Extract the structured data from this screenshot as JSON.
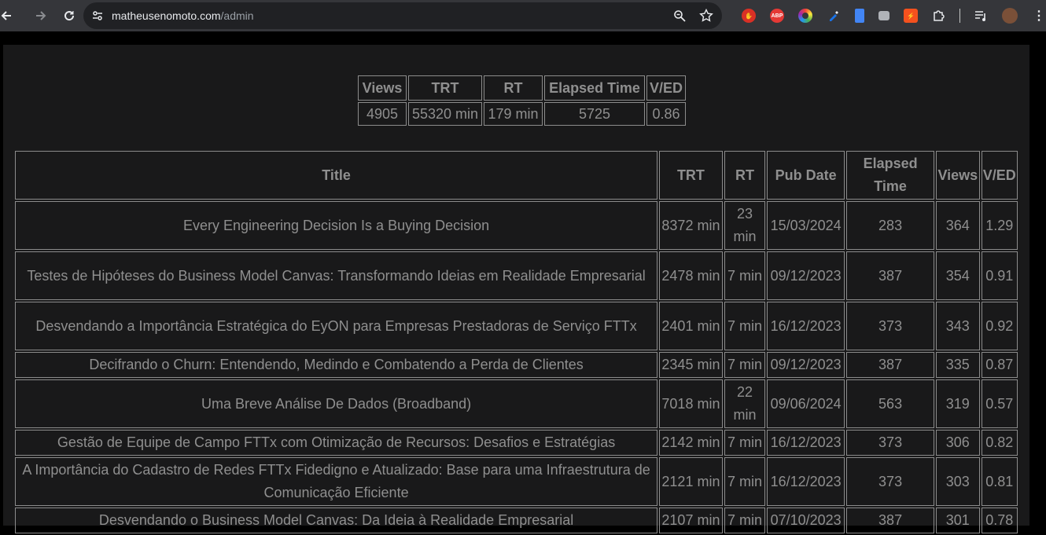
{
  "browser": {
    "url_host": "matheusenomoto.com",
    "url_path": "/admin"
  },
  "summary": {
    "headers": [
      "Views",
      "TRT",
      "RT",
      "Elapsed Time",
      "V/ED"
    ],
    "values": [
      "4905",
      "55320 min",
      "179 min",
      "5725",
      "0.86"
    ]
  },
  "posts": {
    "headers": [
      "Title",
      "TRT",
      "RT",
      "Pub Date",
      "Elapsed Time",
      "Views",
      "V/ED"
    ],
    "rows": [
      {
        "title": "Every Engineering Decision Is a Buying Decision",
        "trt": "8372 min",
        "rt": "23 min",
        "pub_date": "15/03/2024",
        "elapsed": "283",
        "views": "364",
        "ved": "1.29"
      },
      {
        "title": "Testes de Hipóteses do Business Model Canvas: Transformando Ideias em Realidade Empresarial",
        "trt": "2478 min",
        "rt": "7 min",
        "pub_date": "09/12/2023",
        "elapsed": "387",
        "views": "354",
        "ved": "0.91"
      },
      {
        "title": "Desvendando a Importância Estratégica do EyON para Empresas Prestadoras de Serviço FTTx",
        "trt": "2401 min",
        "rt": "7 min",
        "pub_date": "16/12/2023",
        "elapsed": "373",
        "views": "343",
        "ved": "0.92"
      },
      {
        "title": "Decifrando o Churn: Entendendo, Medindo e Combatendo a Perda de Clientes",
        "trt": "2345 min",
        "rt": "7 min",
        "pub_date": "09/12/2023",
        "elapsed": "387",
        "views": "335",
        "ved": "0.87"
      },
      {
        "title": "Uma Breve Análise De Dados (Broadband)",
        "trt": "7018 min",
        "rt": "22 min",
        "pub_date": "09/06/2024",
        "elapsed": "563",
        "views": "319",
        "ved": "0.57"
      },
      {
        "title": "Gestão de Equipe de Campo FTTx com Otimização de Recursos: Desafios e Estratégias",
        "trt": "2142 min",
        "rt": "7 min",
        "pub_date": "16/12/2023",
        "elapsed": "373",
        "views": "306",
        "ved": "0.82"
      },
      {
        "title": "A Importância do Cadastro de Redes FTTx Fidedigno e Atualizado: Base para uma Infraestrutura de Comunicação Eficiente",
        "trt": "2121 min",
        "rt": "7 min",
        "pub_date": "16/12/2023",
        "elapsed": "373",
        "views": "303",
        "ved": "0.81"
      },
      {
        "title": "Desvendando o Business Model Canvas: Da Ideia à Realidade Empresarial",
        "trt": "2107 min",
        "rt": "7 min",
        "pub_date": "07/10/2023",
        "elapsed": "387",
        "views": "301",
        "ved": "0.78"
      }
    ]
  }
}
